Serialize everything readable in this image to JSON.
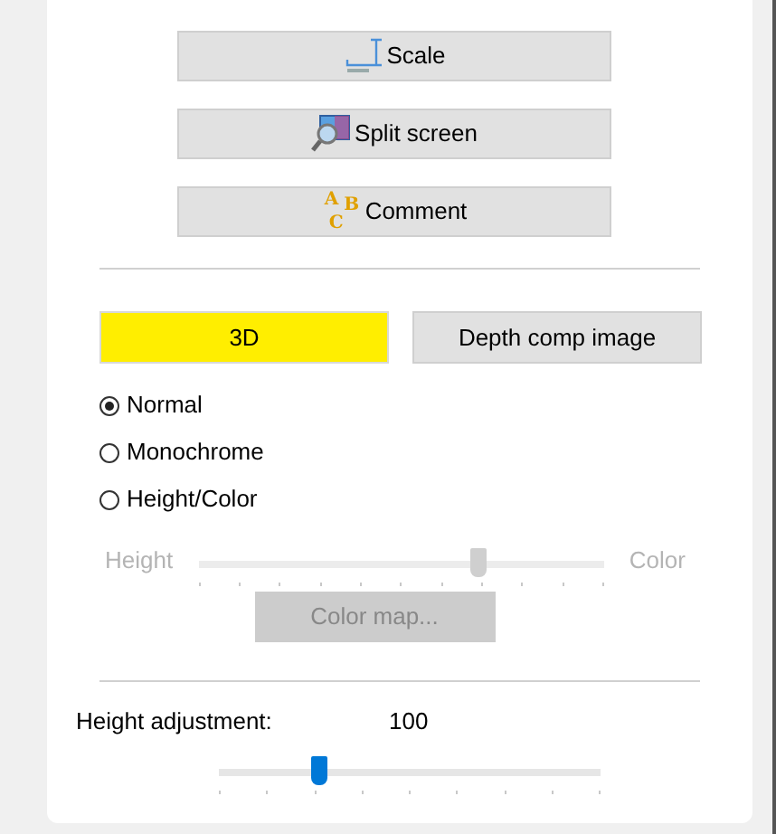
{
  "tool_buttons": [
    {
      "kind": "scale",
      "label": "Scale"
    },
    {
      "kind": "split",
      "label": "Split screen"
    },
    {
      "kind": "comment",
      "label": "Comment",
      "icon_letters": [
        "A",
        "B",
        "C"
      ]
    }
  ],
  "mode_buttons": [
    {
      "label": "3D",
      "selected": true
    },
    {
      "label": "Depth comp image",
      "selected": false
    }
  ],
  "radios": [
    {
      "label": "Normal",
      "selected": true
    },
    {
      "label": "Monochrome",
      "selected": false
    },
    {
      "label": "Height/Color",
      "selected": false
    }
  ],
  "blend_slider": {
    "left_label": "Height",
    "right_label": "Color",
    "level": 0.69,
    "disabled": true
  },
  "color_map_button": {
    "label": "Color map...",
    "disabled": true
  },
  "height_adjustment": {
    "label": "Height adjustment:",
    "value": "100",
    "level": 0.26
  }
}
